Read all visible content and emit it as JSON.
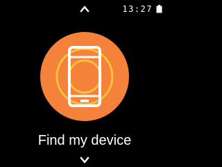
{
  "status": {
    "time": "13:27"
  },
  "feature": {
    "label": "Find my device",
    "icon": "phone-ring-icon"
  },
  "navigation": {
    "up_icon": "chevron-up-icon",
    "down_icon": "chevron-down-icon"
  },
  "colors": {
    "background": "#000000",
    "badge": "#f4823a",
    "ring": "#f8c23a",
    "icon": "#ffffff",
    "text": "#ffffff"
  }
}
